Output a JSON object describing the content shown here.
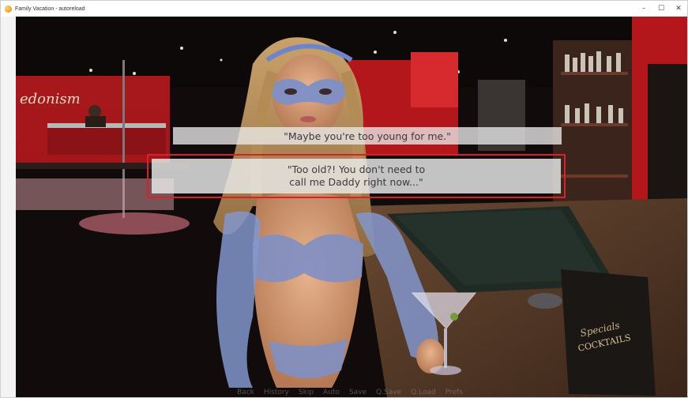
{
  "window": {
    "title": "Family Vacation - autoreload",
    "icon": "app-icon",
    "controls": {
      "minimize": "–",
      "maximize": "☐",
      "close": "✕"
    }
  },
  "scene": {
    "sign_text": "edonism",
    "menu_title": "Specials",
    "menu_subtitle": "COCKTAILS"
  },
  "dialogue": {
    "choices": [
      {
        "text": "\"Maybe you're too young for me.\"",
        "selected": false
      },
      {
        "line1": "\"Too old?! You don't need to",
        "line2": "call me Daddy right now...\"",
        "selected": true
      }
    ],
    "highlight_color": "#d8222a"
  },
  "quick_menu": [
    "Back",
    "History",
    "Skip",
    "Auto",
    "Save",
    "Q.Save",
    "Q.Load",
    "Prefs"
  ]
}
